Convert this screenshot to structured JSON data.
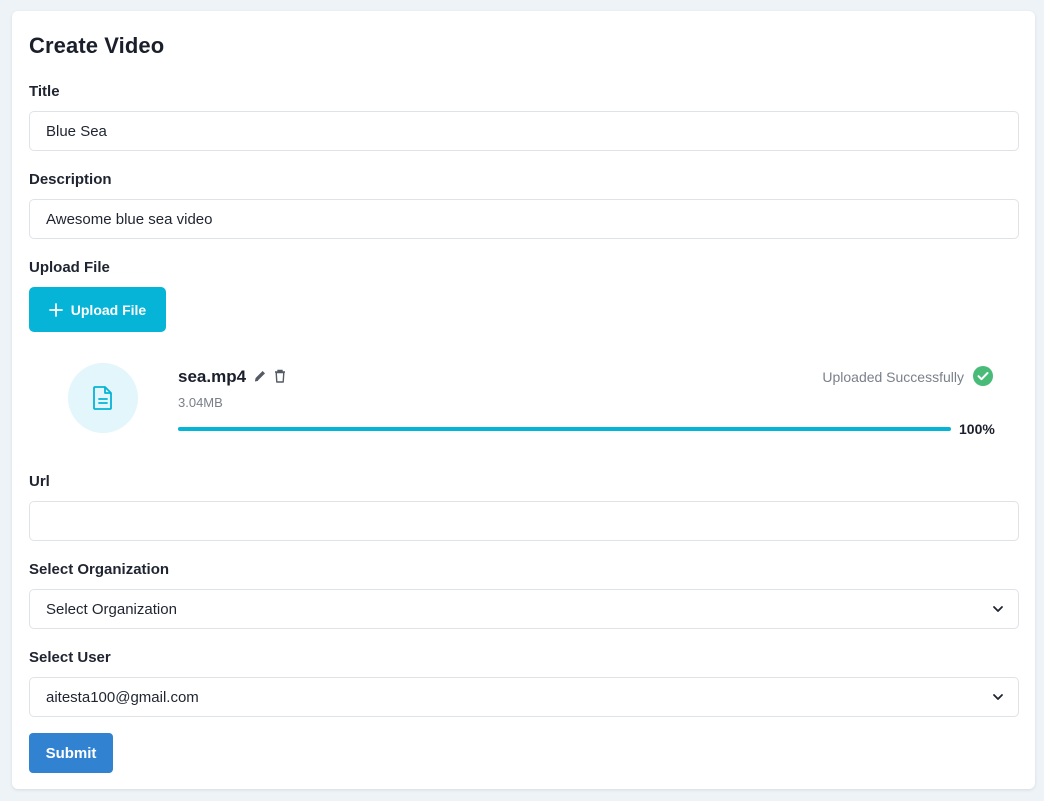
{
  "page": {
    "title": "Create Video"
  },
  "form": {
    "title_label": "Title",
    "title_value": "Blue Sea",
    "description_label": "Description",
    "description_value": "Awesome blue sea video",
    "upload_label": "Upload File",
    "upload_button_label": "Upload File",
    "url_label": "Url",
    "url_value": "",
    "organization_label": "Select Organization",
    "organization_selected": "Select Organization",
    "user_label": "Select User",
    "user_selected": "aitesta100@gmail.com",
    "submit_label": "Submit"
  },
  "file": {
    "name": "sea.mp4",
    "size": "3.04MB",
    "status": "Uploaded Successfully",
    "progress_text": "100%",
    "progress_fraction": 1.0,
    "icon": "document-icon",
    "actions": [
      "edit-icon",
      "trash-icon"
    ]
  },
  "colors": {
    "accent": "#05b4d6",
    "submit": "#3183d1",
    "success": "#48bb78",
    "file_circle_bg": "#e3f6fb"
  }
}
